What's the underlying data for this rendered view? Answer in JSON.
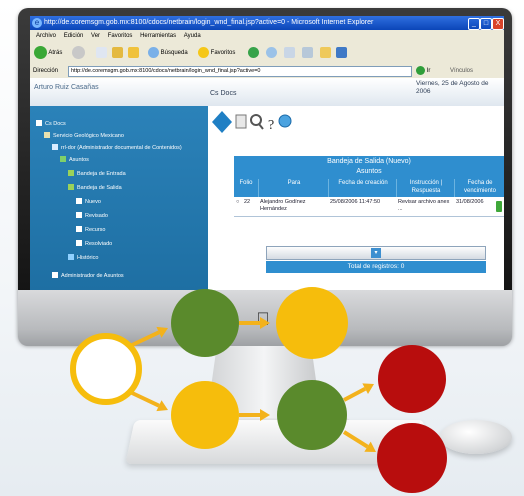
{
  "window": {
    "title": "http://de.coremsgm.gob.mx:8100/cdocs/netbrain/login_wnd_final.jsp?active=0 - Microsoft Internet Explorer",
    "minimize": "_",
    "maximize": "□",
    "close": "X"
  },
  "menu": [
    "Archivo",
    "Edición",
    "Ver",
    "Favoritos",
    "Herramientas",
    "Ayuda"
  ],
  "toolbar": {
    "back": "Atrás",
    "search": "Búsqueda",
    "favorites": "Favoritos"
  },
  "address": {
    "label": "Dirección",
    "url": "http://de.coremsgm.gob.mx:8100/cdocs/netbrain/login_wnd_final.jsp?active=0",
    "go": "Ir",
    "links": "Vínculos"
  },
  "app": {
    "user": "Arturo Ruiz Casañas",
    "section": "Cs Docs",
    "date": "Viernes, 25 de Agosto de 2006"
  },
  "tree": [
    {
      "label": "Cs Docs",
      "level": 0
    },
    {
      "label": "Servicio Geológico Mexicano",
      "level": 1
    },
    {
      "label": "rrl-dor (Administrador documental de Contenidos)",
      "level": 2
    },
    {
      "label": "Asuntos",
      "level": 3
    },
    {
      "label": "Bandeja de Entrada",
      "level": 4
    },
    {
      "label": "Bandeja de Salida",
      "level": 4
    },
    {
      "label": "Nuevo",
      "level": 5
    },
    {
      "label": "Revisado",
      "level": 5
    },
    {
      "label": "Recurso",
      "level": 5
    },
    {
      "label": "Resolviado",
      "level": 5
    },
    {
      "label": "Histórico",
      "level": 4
    },
    {
      "label": "Administrador de Asuntos",
      "level": 2
    }
  ],
  "bandeja": {
    "title_line1": "Bandeja de Salida (Nuevo)",
    "title_line2": "Asuntos",
    "columns": [
      "Folio",
      "Para",
      "Fecha de creación",
      "Instrucción | Respuesta",
      "Fecha de vencimiento"
    ],
    "rows": [
      {
        "folio": "22",
        "para": "Alejandro Godínez Hernández",
        "fecha": "25/08/2006 11:47:50",
        "instruccion": "Revisar archivo anex ...",
        "vencimiento": "31/08/2006"
      }
    ],
    "total": "Total de registros: 0"
  },
  "diagram_colors": {
    "green": "#5a8a2c",
    "yellow": "#f6bd0c",
    "red": "#b80d0d",
    "white": "#ffffff",
    "arrow": "#f3b21c"
  }
}
